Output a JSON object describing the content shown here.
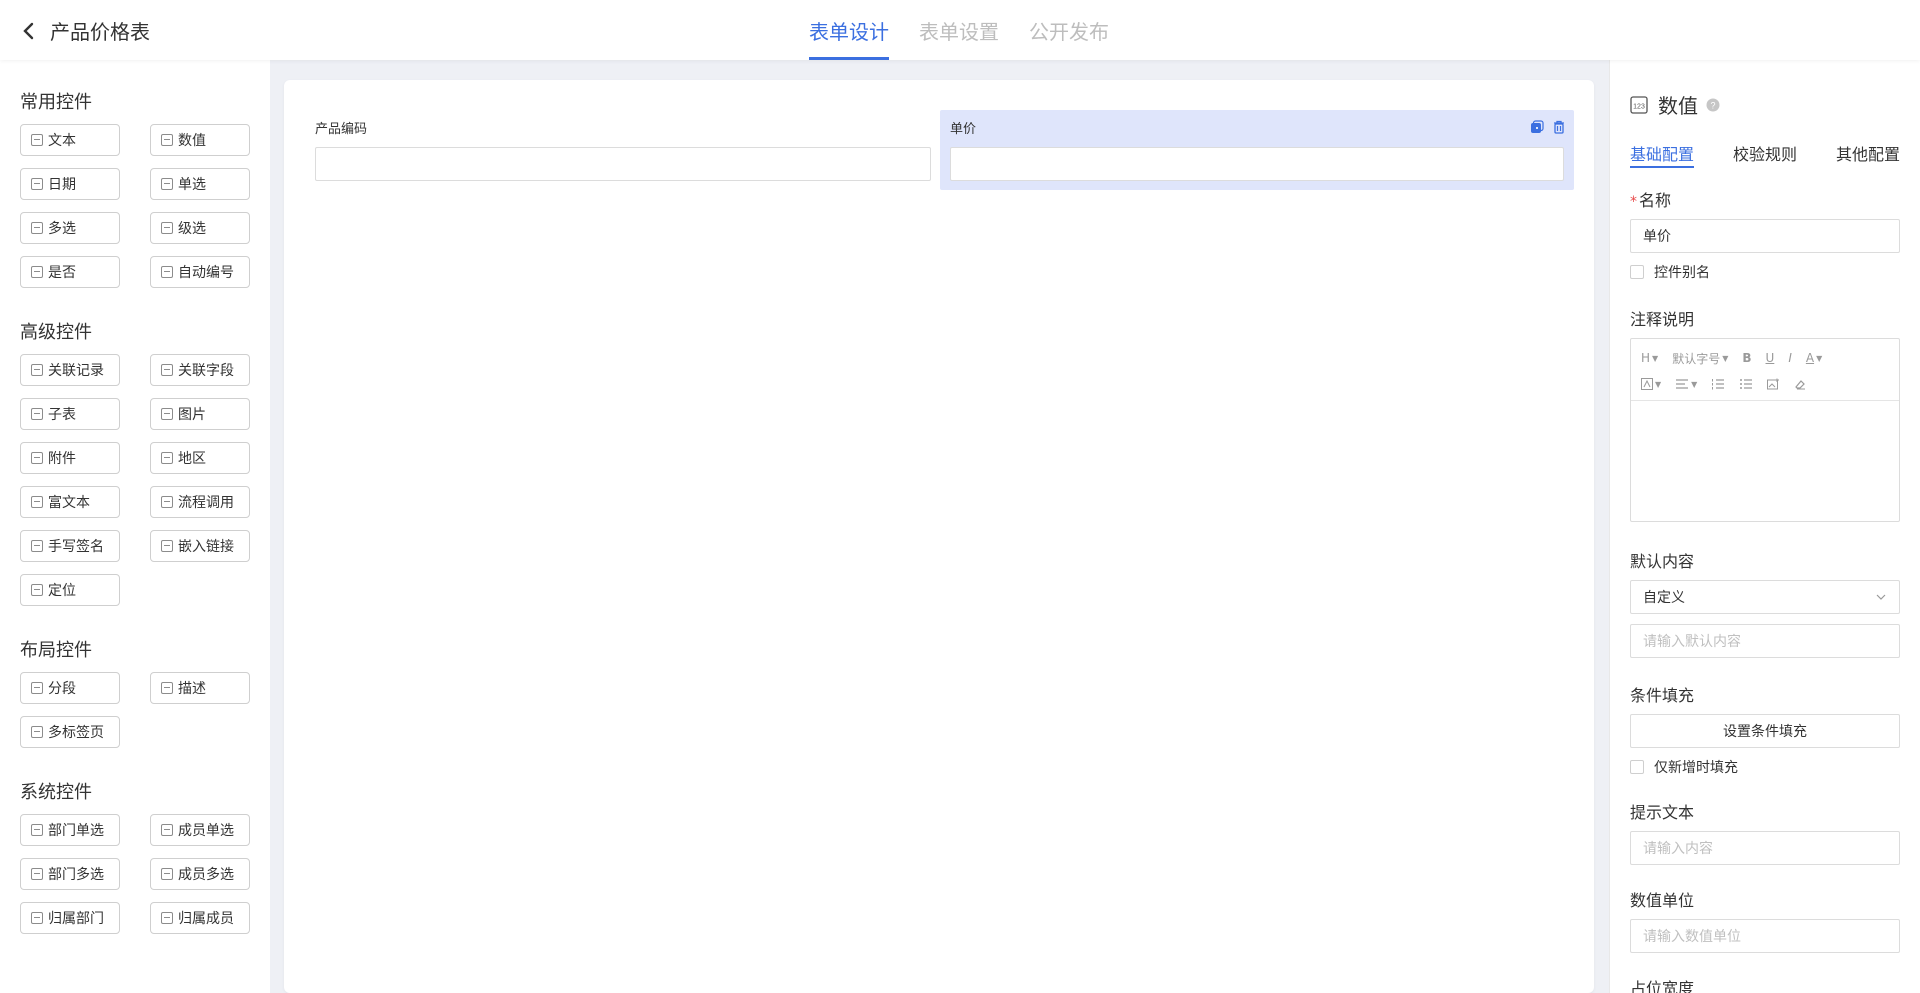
{
  "header": {
    "title": "产品价格表",
    "tabs": [
      {
        "label": "表单设计",
        "active": true
      },
      {
        "label": "表单设置",
        "active": false
      },
      {
        "label": "公开发布",
        "active": false
      }
    ]
  },
  "palette": {
    "groups": [
      {
        "title": "常用控件",
        "items": [
          "文本",
          "数值",
          "日期",
          "单选",
          "多选",
          "级选",
          "是否",
          "自动编号"
        ]
      },
      {
        "title": "高级控件",
        "items": [
          "关联记录",
          "关联字段",
          "子表",
          "图片",
          "附件",
          "地区",
          "富文本",
          "流程调用",
          "手写签名",
          "嵌入链接",
          "定位"
        ]
      },
      {
        "title": "布局控件",
        "items": [
          "分段",
          "描述",
          "多标签页"
        ]
      },
      {
        "title": "系统控件",
        "items": [
          "部门单选",
          "成员单选",
          "部门多选",
          "成员多选",
          "归属部门",
          "归属成员"
        ]
      }
    ]
  },
  "canvas": {
    "fields": [
      {
        "label": "产品编码"
      },
      {
        "label": "单价"
      }
    ]
  },
  "props": {
    "title": "数值",
    "tabs": [
      "基础配置",
      "校验规则",
      "其他配置"
    ],
    "name_label": "名称",
    "name_value": "单价",
    "alias_label": "控件别名",
    "note_label": "注释说明",
    "toolbar": {
      "heading": "H",
      "font_size": "默认字号",
      "bold": "B",
      "underline": "U",
      "italic": "I",
      "font_color": "A"
    },
    "default_label": "默认内容",
    "default_select": "自定义",
    "default_placeholder": "请输入默认内容",
    "cond_label": "条件填充",
    "cond_button": "设置条件填充",
    "only_new_label": "仅新增时填充",
    "hint_label": "提示文本",
    "hint_placeholder": "请输入内容",
    "unit_label": "数值单位",
    "unit_placeholder": "请输入数值单位",
    "width_label": "占位宽度",
    "width_fraction": 0.5
  },
  "colors": {
    "accent": "#3b6fe0",
    "selected_bg": "#dfe5fb",
    "required": "#e84a4a"
  }
}
